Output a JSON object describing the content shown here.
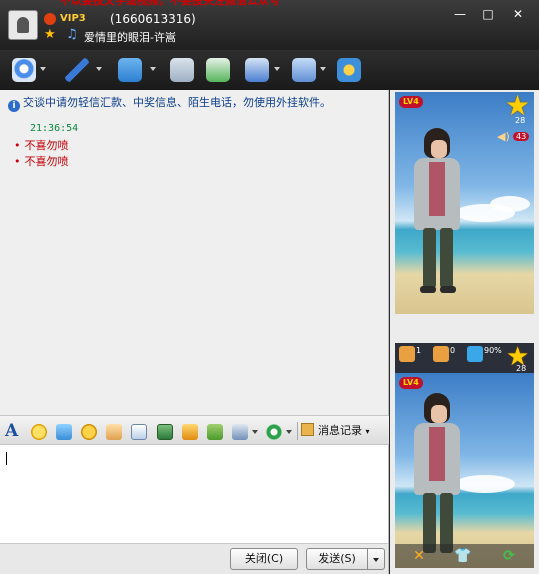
{
  "window": {
    "banner_text": "不以要投文字或视频，不要投关注微信公众号",
    "vip_label": "VIP3",
    "qq_number": "(1660613316)",
    "nickname": "爱情里的眼泪-许嵩",
    "controls": {
      "minimize": "—",
      "maximize": "□",
      "close": "✕"
    }
  },
  "toolbar": {
    "items": [
      {
        "name": "video-call",
        "icon": "webcam-icon",
        "color": "#4a8ee8"
      },
      {
        "name": "voice-call",
        "icon": "microphone-icon",
        "color": "#3a78d8"
      },
      {
        "name": "send-file",
        "icon": "folder-icon",
        "color": "#e8a030"
      },
      {
        "name": "send-mail",
        "icon": "mail-icon",
        "color": "#8aa0c0"
      },
      {
        "name": "create-discussion",
        "icon": "discussion-add-icon",
        "color": "#44a84a"
      },
      {
        "name": "remote-assist",
        "icon": "assist-icon",
        "color": "#4a7fd0"
      },
      {
        "name": "app-settings",
        "icon": "apps-icon",
        "color": "#5f8fd6"
      },
      {
        "name": "share",
        "icon": "share-icon",
        "color": "#3c8fd8"
      }
    ]
  },
  "chat": {
    "notice": "交谈中请勿轻信汇款、中奖信息、陌生电话，勿使用外挂软件。",
    "messages": {
      "time": "21:36:54",
      "lines": [
        "不喜勿喷",
        "不喜勿喷"
      ]
    }
  },
  "format_bar": {
    "font_glyph": "A",
    "history_label": "消息记录"
  },
  "input": {
    "value": ""
  },
  "buttons": {
    "close_label": "关闭(C)",
    "send_label": "发送(S)"
  },
  "show_panel": {
    "level_top": "LV4",
    "level_bottom": "LV4",
    "star_count_top": "28",
    "volume_top": "43",
    "likes": "1",
    "dislikes": "0",
    "pk_percent": "90%",
    "star_count_mid": "28",
    "colors": {
      "accent": "#c2102a",
      "star": "#ffcc00"
    }
  }
}
